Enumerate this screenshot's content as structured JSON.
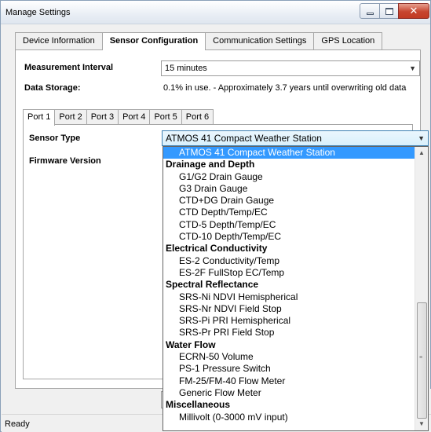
{
  "window": {
    "title": "Manage Settings",
    "min_glyph": "minimize-icon",
    "max_glyph": "maximize-icon",
    "close_glyph": "✕"
  },
  "main_tabs": [
    {
      "label": "Device Information",
      "active": false
    },
    {
      "label": "Sensor Configuration",
      "active": true
    },
    {
      "label": "Communication Settings",
      "active": false
    },
    {
      "label": "GPS Location",
      "active": false
    }
  ],
  "measurement": {
    "label": "Measurement Interval",
    "value": "15 minutes"
  },
  "storage": {
    "label": "Data Storage:",
    "value": "0.1% in use.  - Approximately 3.7 years until overwriting old data"
  },
  "port_tabs": [
    {
      "label": "Port 1",
      "active": true
    },
    {
      "label": "Port 2",
      "active": false
    },
    {
      "label": "Port 3",
      "active": false
    },
    {
      "label": "Port 4",
      "active": false
    },
    {
      "label": "Port 5",
      "active": false
    },
    {
      "label": "Port 6",
      "active": false
    }
  ],
  "sensor_type": {
    "label": "Sensor Type",
    "value": "ATMOS 41 Compact Weather Station"
  },
  "firmware": {
    "label": "Firmware Version"
  },
  "dropdown": {
    "options": [
      {
        "text": "ATMOS 41 Compact Weather Station",
        "kind": "item",
        "selected": true
      },
      {
        "text": "Drainage and Depth",
        "kind": "group"
      },
      {
        "text": "G1/G2 Drain Gauge",
        "kind": "item"
      },
      {
        "text": "G3 Drain Gauge",
        "kind": "item"
      },
      {
        "text": "CTD+DG Drain Gauge",
        "kind": "item"
      },
      {
        "text": "CTD Depth/Temp/EC",
        "kind": "item"
      },
      {
        "text": "CTD-5 Depth/Temp/EC",
        "kind": "item"
      },
      {
        "text": "CTD-10 Depth/Temp/EC",
        "kind": "item"
      },
      {
        "text": "Electrical Conductivity",
        "kind": "group"
      },
      {
        "text": "ES-2 Conductivity/Temp",
        "kind": "item"
      },
      {
        "text": "ES-2F FullStop EC/Temp",
        "kind": "item"
      },
      {
        "text": "Spectral Reflectance",
        "kind": "group"
      },
      {
        "text": "SRS-Ni NDVI Hemispherical",
        "kind": "item"
      },
      {
        "text": "SRS-Nr NDVI Field Stop",
        "kind": "item"
      },
      {
        "text": "SRS-Pi PRI Hemispherical",
        "kind": "item"
      },
      {
        "text": "SRS-Pr PRI Field Stop",
        "kind": "item"
      },
      {
        "text": "Water Flow",
        "kind": "group"
      },
      {
        "text": "ECRN-50 Volume",
        "kind": "item"
      },
      {
        "text": "PS-1 Pressure Switch",
        "kind": "item"
      },
      {
        "text": "FM-25/FM-40 Flow Meter",
        "kind": "item"
      },
      {
        "text": "Generic Flow Meter",
        "kind": "item"
      },
      {
        "text": "Miscellaneous",
        "kind": "group"
      },
      {
        "text": "Millivolt (0-3000 mV input)",
        "kind": "item"
      }
    ]
  },
  "status": {
    "text": "Ready"
  },
  "icons": {
    "combo_arrow": "chevron-down-icon",
    "scroll_up": "scroll-up-arrow-icon",
    "scroll_down": "scroll-down-arrow-icon"
  },
  "colors": {
    "selection": "#3399ff",
    "close_button": "#c7442f",
    "panel_border": "#a6a6a6"
  }
}
